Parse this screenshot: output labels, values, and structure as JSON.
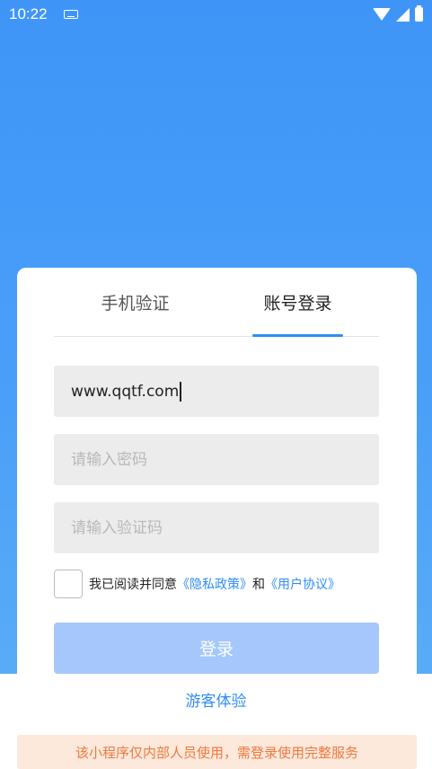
{
  "status_bar": {
    "time": "10:22"
  },
  "tabs": [
    {
      "label": "手机验证",
      "active": false
    },
    {
      "label": "账号登录",
      "active": true
    }
  ],
  "form": {
    "account_value": "www.qqtf.com",
    "password_placeholder": "请输入密码",
    "captcha_placeholder": "请输入验证码"
  },
  "agreement": {
    "prefix": "我已阅读并同意",
    "privacy_link": "《隐私政策》",
    "and": "和",
    "user_link": "《用户协议》",
    "checked": false
  },
  "login_button": "登录",
  "guest_link": "游客体验",
  "notice": "该小程序仅内部人员使用，需登录使用完整服务",
  "colors": {
    "primary": "#2f8df5",
    "background_top": "#3f95f7",
    "button_disabled": "#a5c7fb",
    "notice_bg": "#fde8dc",
    "notice_text": "#ec7a3c"
  }
}
